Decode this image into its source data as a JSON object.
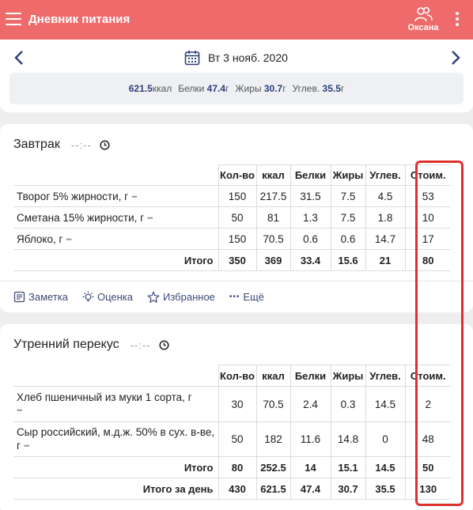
{
  "header": {
    "title": "Дневник питания",
    "user_name": "Оксана",
    "bg_color": "#ef6b6b"
  },
  "date_bar": {
    "date": "Вт 3 нояб. 2020",
    "totals": {
      "kcal_value": "621.5",
      "kcal_unit": "ккал",
      "protein_label": "Белки",
      "protein_value": "47.4",
      "protein_unit": "г",
      "fat_label": "Жиры",
      "fat_value": "30.7",
      "fat_unit": "г",
      "carbs_label": "Углев.",
      "carbs_value": "35.5",
      "carbs_unit": "г"
    }
  },
  "columns": [
    "Кол-во",
    "ккал",
    "Белки",
    "Жиры",
    "Углев.",
    "Стоим."
  ],
  "meals": [
    {
      "title": "Завтрак",
      "time": "--:--",
      "items": [
        {
          "name": "Творог 5% жирности, г",
          "qty": "150",
          "kcal": "217.5",
          "protein": "31.5",
          "fat": "7.5",
          "carbs": "4.5",
          "cost": "53"
        },
        {
          "name": "Сметана 15% жирности, г",
          "qty": "50",
          "kcal": "81",
          "protein": "1.3",
          "fat": "7.5",
          "carbs": "1.8",
          "cost": "10"
        },
        {
          "name": "Яблоко, г",
          "qty": "150",
          "kcal": "70.5",
          "protein": "0.6",
          "fat": "0.6",
          "carbs": "14.7",
          "cost": "17"
        }
      ],
      "total": {
        "label": "Итого",
        "qty": "350",
        "kcal": "369",
        "protein": "33.4",
        "fat": "15.6",
        "carbs": "21",
        "cost": "80"
      },
      "actions": {
        "note": "Заметка",
        "rating": "Оценка",
        "favorite": "Избранное",
        "more": "Ещё"
      }
    },
    {
      "title": "Утренний перекус",
      "time": "--:--",
      "items": [
        {
          "name": "Хлеб пшеничный из муки 1 сорта, г",
          "qty": "30",
          "kcal": "70.5",
          "protein": "2.4",
          "fat": "0.3",
          "carbs": "14.5",
          "cost": "2"
        },
        {
          "name": "Сыр российский, м.д.ж. 50% в сух. в-ве, г",
          "qty": "50",
          "kcal": "182",
          "protein": "11.6",
          "fat": "14.8",
          "carbs": "0",
          "cost": "48"
        }
      ],
      "total": {
        "label": "Итого",
        "qty": "80",
        "kcal": "252.5",
        "protein": "14",
        "fat": "15.1",
        "carbs": "14.5",
        "cost": "50"
      },
      "day_total": {
        "label": "Итого за день",
        "qty": "430",
        "kcal": "621.5",
        "protein": "47.4",
        "fat": "30.7",
        "carbs": "35.5",
        "cost": "130"
      }
    }
  ],
  "accent": {
    "link_color": "#3d4a7a",
    "highlight_color": "#e0302e"
  }
}
